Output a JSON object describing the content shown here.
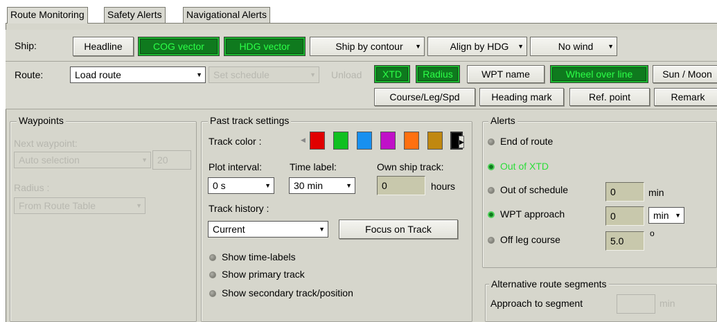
{
  "tabs": [
    "Route Monitoring",
    "Safety Alerts",
    "Navigational Alerts"
  ],
  "ship_row": {
    "label": "Ship:",
    "headline": "Headline",
    "cog_vector": "COG vector",
    "hdg_vector": "HDG vector",
    "ship_by_contour": "Ship by contour",
    "align_by_hdg": "Align by HDG",
    "wind": "No wind"
  },
  "route_row": {
    "label": "Route:",
    "load_route": "Load route",
    "set_schedule": "Set schedule",
    "unload": "Unload",
    "xtd": "XTD",
    "radius": "Radius",
    "wpt_name": "WPT name",
    "wheel_over_line": "Wheel over line",
    "sun_moon": "Sun / Moon",
    "course_leg_spd": "Course/Leg/Spd",
    "heading_mark": "Heading mark",
    "ref_point": "Ref. point",
    "remark": "Remark"
  },
  "waypoints": {
    "title": "Waypoints",
    "next_waypoint_label": "Next waypoint:",
    "next_waypoint_value": "Auto selection",
    "next_waypoint_number": "20",
    "radius_label": "Radius :",
    "radius_value": "From Route Table"
  },
  "past_track": {
    "title": "Past track settings",
    "track_color_label": "Track color :",
    "colors": [
      "#e00000",
      "#10c020",
      "#1890f0",
      "#c010c8",
      "#ff7010",
      "#c08810",
      "#000000"
    ],
    "plot_interval_label": "Plot interval:",
    "plot_interval_value": "0 s",
    "time_label_label": "Time label:",
    "time_label_value": "30 min",
    "own_ship_track_label": "Own ship track:",
    "own_ship_track_value": "0",
    "own_ship_track_unit": "hours",
    "track_history_label": "Track history :",
    "track_history_value": "Current",
    "focus_on_track": "Focus on Track",
    "show_time_labels": "Show time-labels",
    "show_primary_track": "Show primary track",
    "show_secondary_track": "Show secondary track/position"
  },
  "alerts": {
    "title": "Alerts",
    "end_of_route": "End of route",
    "out_of_xtd": "Out of XTD",
    "out_of_schedule": "Out of schedule",
    "out_of_schedule_value": "0",
    "out_of_schedule_unit": "min",
    "wpt_approach": "WPT approach",
    "wpt_approach_value": "0",
    "wpt_approach_unit": "min",
    "off_leg_course": "Off leg course",
    "off_leg_course_value": "5.0",
    "off_leg_course_unit": "o"
  },
  "alt_route": {
    "title": "Alternative route segments",
    "approach_label": "Approach to segment",
    "approach_value": "",
    "approach_unit": "min"
  }
}
